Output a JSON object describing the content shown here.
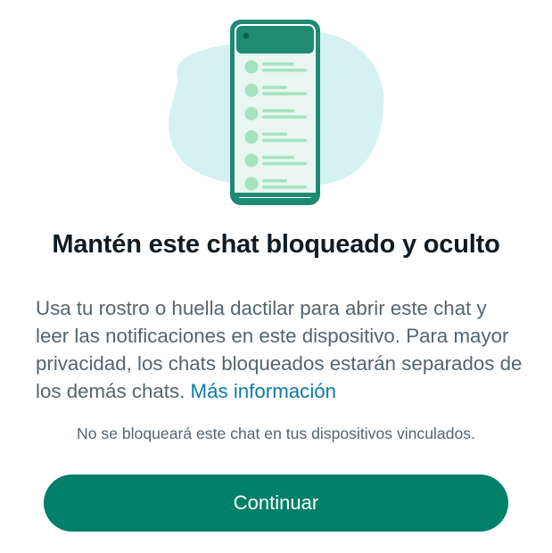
{
  "colors": {
    "accent": "#008069",
    "link": "#0a7ca8",
    "illustration_blob": "#d5f2f0",
    "illustration_phone": "#1e8a72",
    "illustration_avatar": "#a4e3c0"
  },
  "illustration": {
    "icon": "phone-chat-list-icon",
    "chat_rows": 6
  },
  "dialog": {
    "title": "Mantén este chat bloqueado y oculto",
    "body": "Usa tu rostro o huella dactilar para abrir este chat y leer las notificaciones en este dispositivo. Para mayor privacidad, los chats bloqueados estarán separados de los demás chats.",
    "link": "Más información",
    "note": "No se bloqueará este chat en tus dispositivos vinculados.",
    "continue_label": "Continuar"
  }
}
